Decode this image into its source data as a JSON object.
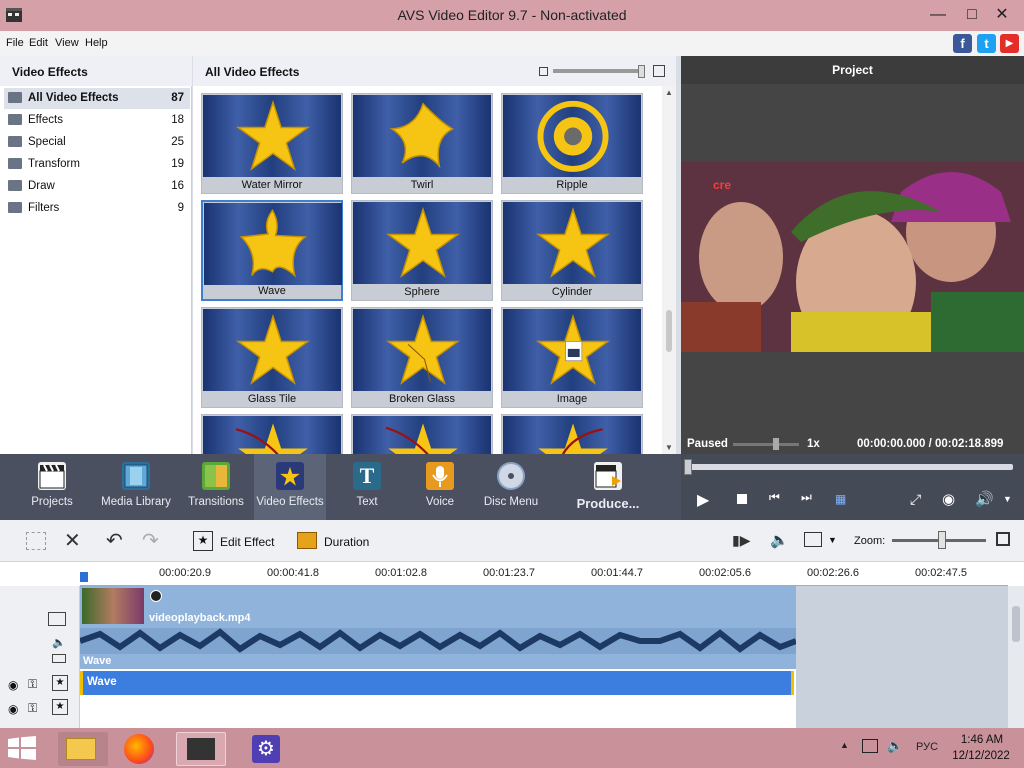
{
  "window": {
    "title": "AVS Video Editor 9.7 - Non-activated"
  },
  "menu": [
    "File",
    "Edit",
    "View",
    "Help"
  ],
  "social": [
    "f",
    "t",
    "▶"
  ],
  "left_panel": {
    "header": "Video Effects",
    "categories": [
      {
        "label": "All Video Effects",
        "count": "87"
      },
      {
        "label": "Effects",
        "count": "18"
      },
      {
        "label": "Special",
        "count": "25"
      },
      {
        "label": "Transform",
        "count": "19"
      },
      {
        "label": "Draw",
        "count": "16"
      },
      {
        "label": "Filters",
        "count": "9"
      }
    ]
  },
  "mid_panel": {
    "header": "All Video Effects",
    "effects": [
      "Water Mirror",
      "Twirl",
      "Ripple",
      "Wave",
      "Sphere",
      "Cylinder",
      "Glass Tile",
      "Broken Glass",
      "Image"
    ]
  },
  "right_panel": {
    "header": "Project",
    "video_text": "cre",
    "status": "Paused",
    "speed": "1x",
    "time": "00:00:00.000 / 00:02:18.899"
  },
  "toolbar": {
    "buttons": [
      "Projects",
      "Media Library",
      "Transitions",
      "Video Effects",
      "Text",
      "Voice",
      "Disc Menu",
      "Produce..."
    ]
  },
  "edit_toolbar": {
    "edit_effect": "Edit Effect",
    "duration": "Duration",
    "zoom": "Zoom:"
  },
  "timeline": {
    "ticks": [
      "00:00:20.9",
      "00:00:41.8",
      "00:01:02.8",
      "00:01:23.7",
      "00:01:44.7",
      "00:02:05.6",
      "00:02:26.6",
      "00:02:47.5"
    ],
    "clip_name": "videoplayback.mp4",
    "effect_label_small": "Wave",
    "effect_label_track": "Wave"
  },
  "taskbar": {
    "lang": "РУС",
    "time": "1:46 AM",
    "date": "12/12/2022"
  },
  "colors": {
    "accent": "#3d7fd1",
    "toolbar": "#4a5060",
    "titlebar": "#d5a0a7",
    "taskbar": "#c9919a"
  }
}
